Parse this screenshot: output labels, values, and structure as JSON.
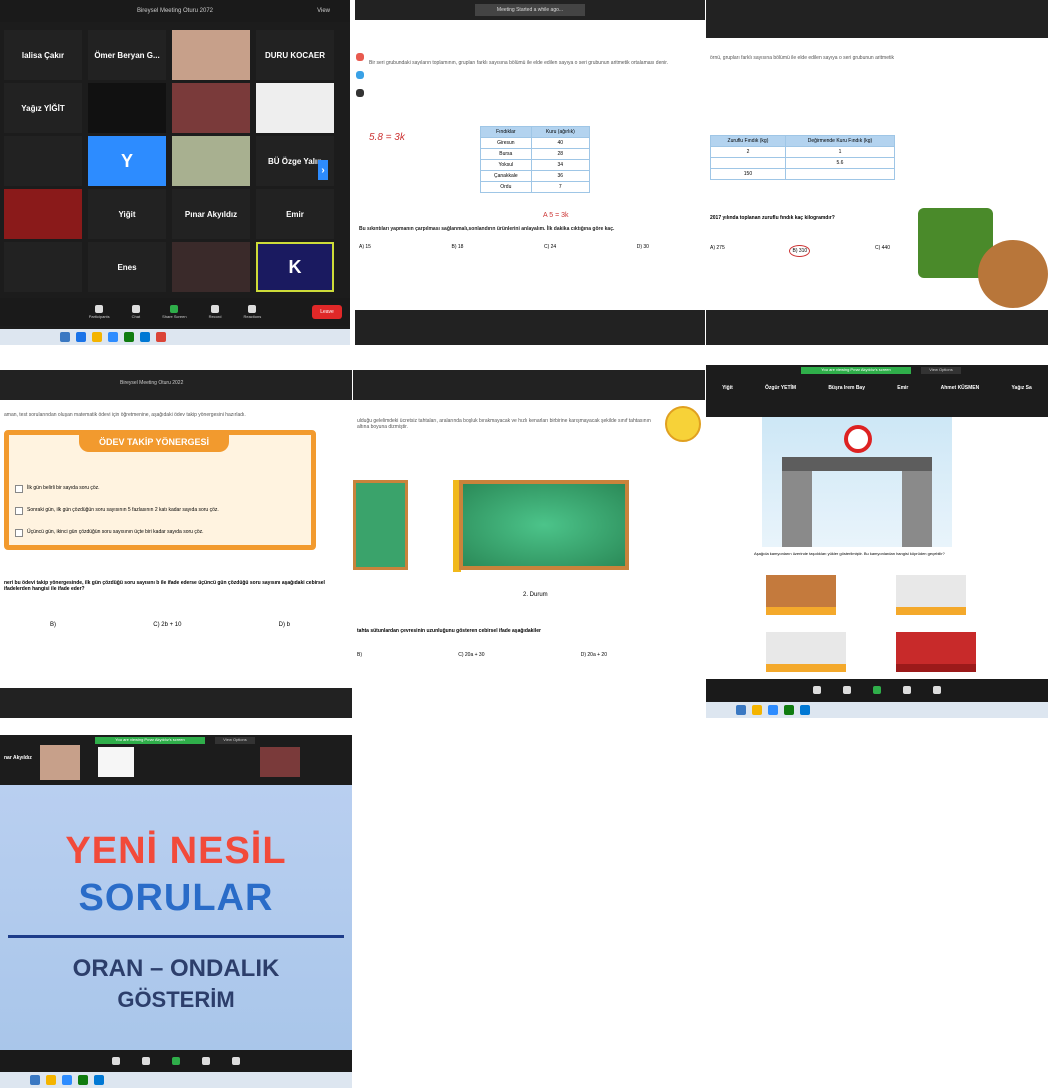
{
  "panel1": {
    "title": "Bireysel Meeting Oturu 2072",
    "view": "View",
    "participants": [
      {
        "name": "lalisa Çakır"
      },
      {
        "name": "Ömer Beryan G..."
      },
      {
        "name": ""
      },
      {
        "name": "DURU KOCAER"
      },
      {
        "name": "Yağız YİĞİT"
      },
      {
        "name": ""
      },
      {
        "name": ""
      },
      {
        "name": ""
      },
      {
        "name": ""
      },
      {
        "name": "Y"
      },
      {
        "name": ""
      },
      {
        "name": "BÜ Özge Yalın"
      },
      {
        "name": ""
      },
      {
        "name": "Yiğit"
      },
      {
        "name": "Pınar Akyıldız"
      },
      {
        "name": "Emir"
      },
      {
        "name": ""
      },
      {
        "name": "Enes"
      },
      {
        "name": ""
      },
      {
        "name": "K"
      }
    ],
    "leave": "Leave"
  },
  "panel2": {
    "top": "Meeting Started a while ago...",
    "table": {
      "headers": [
        "Fındıklar",
        "Kuru (ağırlık)"
      ],
      "rows": [
        [
          "Giresun",
          "40"
        ],
        [
          "Bursa",
          "28"
        ],
        [
          "Yoksul",
          "34"
        ],
        [
          "Çanakkale",
          "36"
        ],
        [
          "Ordu",
          "7"
        ]
      ]
    },
    "note": "A 5 = 3k",
    "question": "Bu sıkıntıları yapmanın çarpılması sağlanmalı,sonlandırın ürünlerini anlayalım. İlk dakika cıktığına göre kaç.",
    "answers": [
      "A) 15",
      "B) 18",
      "C) 24",
      "D) 30"
    ]
  },
  "panel3": {
    "table": {
      "headers": [
        "Zuruflu Fındık (kg)",
        "Değirmende Kuru Fındık (kg)"
      ],
      "rows": [
        [
          "2",
          "1"
        ],
        [
          "",
          "5.6"
        ],
        [
          "150",
          ""
        ]
      ]
    },
    "question": "2017 yılında toplanan zuruflu fındık kaç kilogramdır?",
    "answers": [
      "A) 275",
      "B) 310",
      "C) 440"
    ]
  },
  "panel4": {
    "top": "Bireysel Meeting Oturu 2022",
    "intro": "aman, test sorularından oluşan matematik ödevi için öğretmenine, aşağıdaki ödev takip yönergesini hazırladı.",
    "box_title": "ÖDEV TAKİP YÖNERGESİ",
    "items": [
      "İlk gün belirli bir sayıda soru çöz.",
      "Sonraki gün, ilk gün çözdüğün soru sayısının 5 fazlasının 2 katı kadar sayıda soru çöz.",
      "Üçüncü gün, ikinci gün çözdüğün soru sayısının üçte biri kadar sayıda soru çöz."
    ],
    "question": "neri bu ödevi takip yönergesinde, ilk gün çözdüğü soru sayısını b ile ifade ederse üçüncü gün çözdüğü soru sayısını aşağıdaki cebirsel ifadelerden hangisi ile ifade eder?",
    "answers": [
      "B)",
      "C) 2b + 10",
      "D) b"
    ]
  },
  "panel5": {
    "text": "ulduğu gelelimdeki ücretsiz tahtaları, aralarında boşluk bırakmayacak ve hızlı kenarları birbirine karışmayacak şekilde sınıf tahtasının altına boyuna dizmiştir.",
    "label": "2. Durum",
    "question": "tahta sütunlardan çevresinin uzunluğunu gösteren cebirsel ifade aşağıdakiler",
    "answers": [
      "B)",
      "C) 20a + 30",
      "D) 20a + 20"
    ]
  },
  "panel6": {
    "top": "You are viewing Pınar Akyıldız's screen",
    "options": "View Options",
    "names": [
      "Yiğit",
      "Özgür YETİM",
      "Büşra Irem Bay",
      "Emir",
      "Ahmet KÜSMEN",
      "Yağız Sa"
    ],
    "question": "Aşağıda kamyonların üzerinde taşıdıkları yükler gösterilmiştir. Bu kamyonlardan hangisi köprüden geçebilir?"
  },
  "panel7": {
    "top": "You are viewing Pınar Akyıldız's screen",
    "options": "View Options",
    "presenter": "nar Akyıldız",
    "title1": "YENİ NESİL",
    "title2": "SORULAR",
    "subtitle1": "ORAN – ONDALIK",
    "subtitle2": "GÖSTERİM"
  },
  "colors": {
    "zoom_dark": "#1c1c1c",
    "leave_red": "#e02828",
    "orange": "#f29a2e",
    "green_board": "#3aa36b",
    "slide_blue": "#a9c6ea"
  }
}
